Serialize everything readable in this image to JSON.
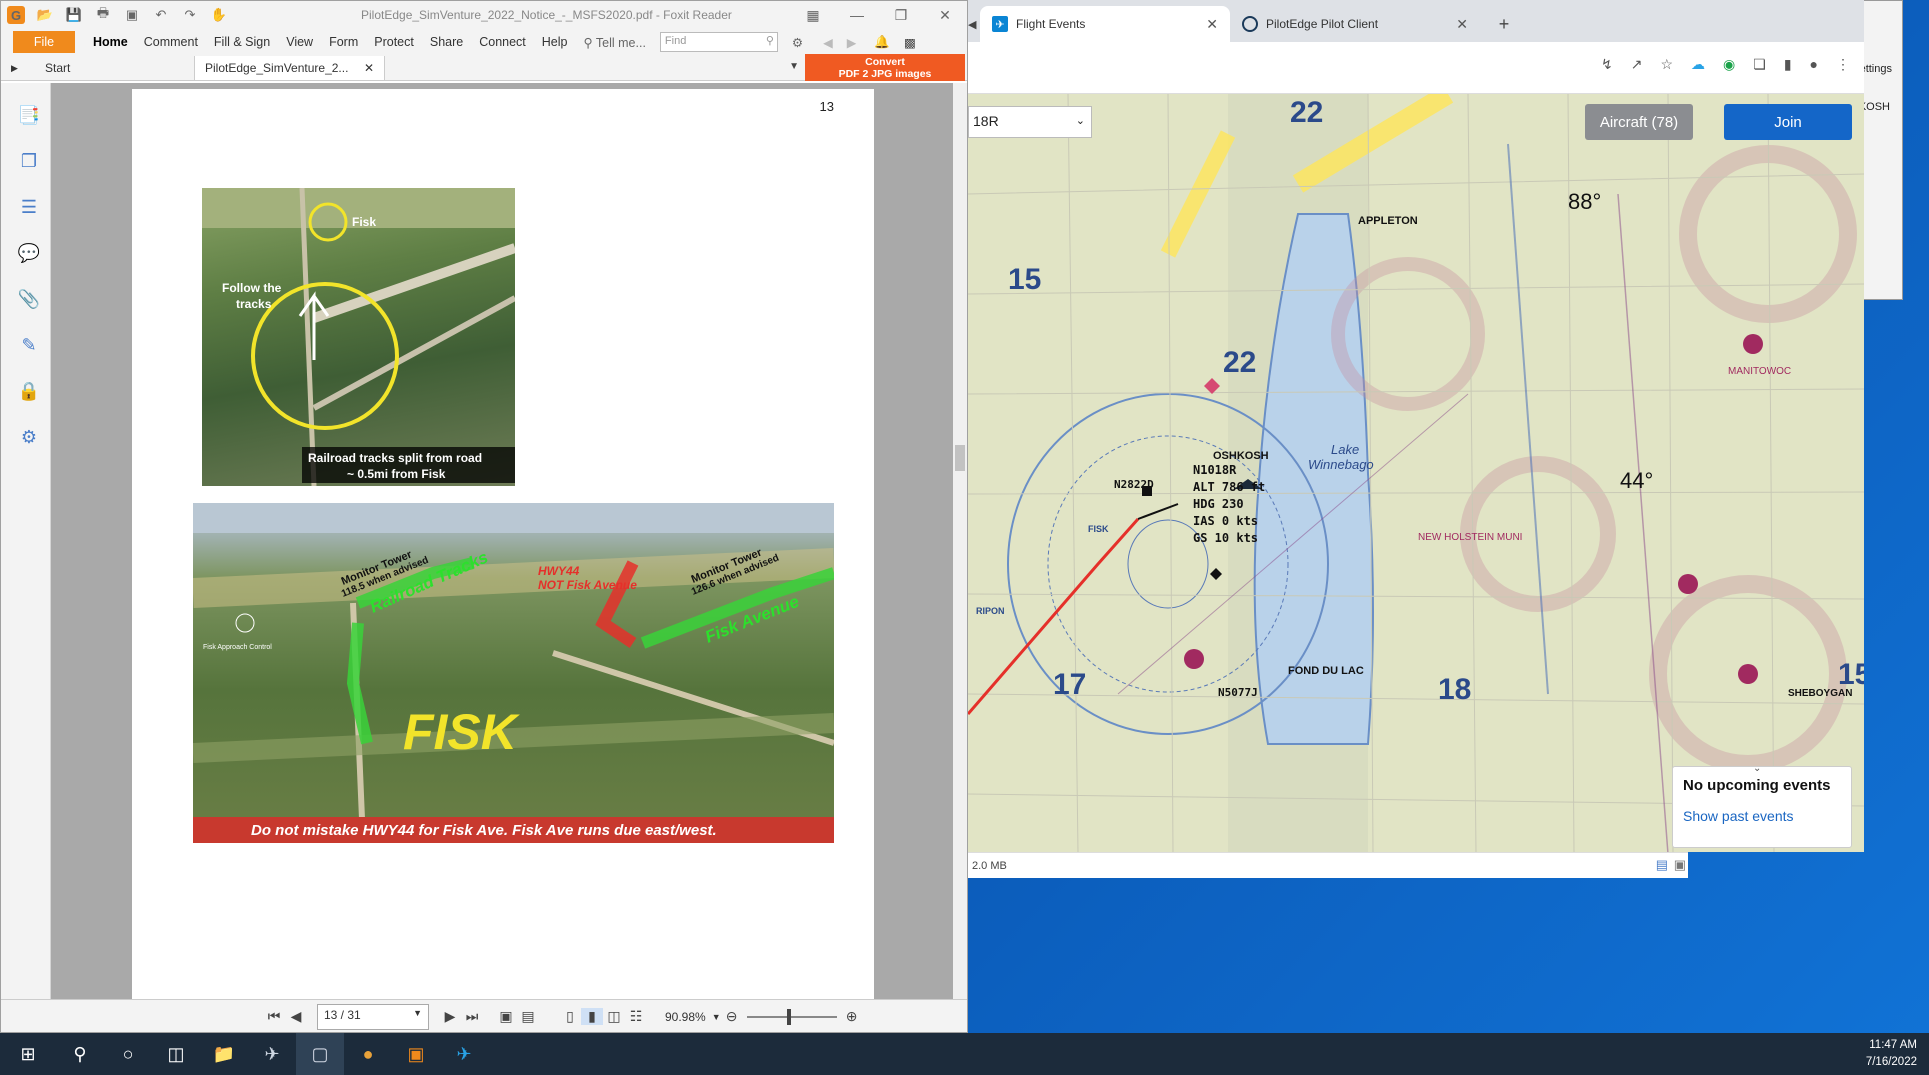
{
  "foxit": {
    "title": "PilotEdge_SimVenture_2022_Notice_-_MSFS2020.pdf - Foxit Reader",
    "menu": [
      "Home",
      "Comment",
      "Fill & Sign",
      "View",
      "Form",
      "Protect",
      "Share",
      "Connect",
      "Help"
    ],
    "file_label": "File",
    "tell_me": "Tell me...",
    "find_placeholder": "Find",
    "tabs": {
      "start": "Start",
      "doc": "PilotEdge_SimVenture_2..."
    },
    "convert": {
      "line1": "Convert",
      "line2": "PDF 2 JPG images"
    },
    "page_number": "13",
    "page_box": "13 / 31",
    "zoom": "90.98%"
  },
  "doc": {
    "img1": {
      "fisk": "Fisk",
      "follow1": "Follow the",
      "follow2": "tracks",
      "caption1": "Railroad tracks split from road",
      "caption2": "~ 0.5mi from Fisk"
    },
    "img2": {
      "monitor_left": "Monitor Tower",
      "monitor_left2": "118.5 when advised",
      "railroad": "Railroad Tracks",
      "hwy": "HWY44",
      "notfisk": "NOT Fisk Avenue",
      "monitor_right": "Monitor Tower",
      "monitor_right2": "126.6 when advised",
      "fiskave": "Fisk Avenue",
      "fisk_big": "FISK",
      "approach": "Fisk Approach Control",
      "banner": "Do not mistake HWY44 for Fisk Ave. Fisk Ave runs due east/west."
    }
  },
  "browser": {
    "tabs": [
      {
        "label": "Flight Events"
      },
      {
        "label": "PilotEdge Pilot Client"
      }
    ],
    "runway_select": "18R",
    "aircraft_btn": "Aircraft (78)",
    "join_btn": "Join",
    "events": {
      "title": "No upcoming events",
      "link": "Show past events"
    },
    "status": "2.0 MB",
    "aircraft_label": {
      "callsign": "N1018R",
      "alt": "ALT 786 ft",
      "hdg": "HDG 230",
      "ias": "IAS 0 kts",
      "gs": "GS 10 kts"
    },
    "other_callsign": "N2822D",
    "other_callsign2": "N5077J"
  },
  "map_labels": {
    "lake": "Lake",
    "winnebago": "Winnebago",
    "oshkosh": "OSHKOSH",
    "appleton": "APPLETON",
    "fond_du_lac": "FOND DU LAC",
    "fisk": "FISK",
    "ripon": "RIPON",
    "sheboygan": "SHEBOYGAN",
    "new_holstein": "NEW HOLSTEIN MUNI",
    "manitowoc": "MANITOWOC",
    "num22": "22",
    "num17": "17",
    "num18": "18",
    "num15": "15",
    "num88": "88°",
    "num44": "44°"
  },
  "pe_client": {
    "settings": "ettings",
    "kosh": "KOSH"
  },
  "clock": {
    "time": "11:47 AM",
    "date": "7/16/2022"
  }
}
